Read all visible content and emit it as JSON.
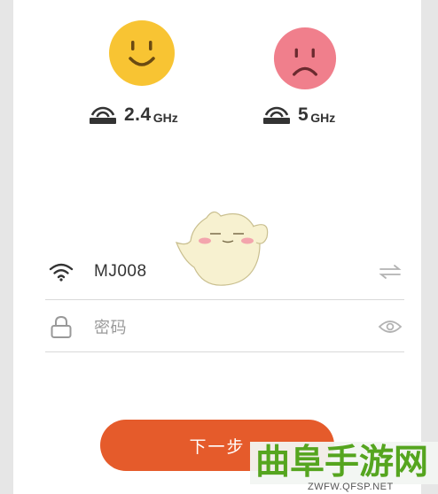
{
  "bands": [
    {
      "mood": "happy",
      "face_color": "#f8c433",
      "icon": "router-icon",
      "value": "2.4",
      "unit": "GHz"
    },
    {
      "mood": "sad",
      "face_color": "#f07f8c",
      "icon": "router-icon",
      "value": "5",
      "unit": "GHz"
    }
  ],
  "wifi_row": {
    "icon": "wifi-icon",
    "ssid": "MJ008",
    "trail_icon": "switch-network-icon"
  },
  "password_row": {
    "icon": "lock-icon",
    "placeholder": "密码",
    "trail_icon": "eye-icon"
  },
  "next_button": {
    "label": "下一步",
    "color": "#e55b2b"
  },
  "mascot": {
    "icon": "mascot-chick-icon"
  },
  "watermark": {
    "title": "曲阜手游网",
    "url": "ZWFW.QFSP.NET",
    "color": "#55a51f"
  }
}
